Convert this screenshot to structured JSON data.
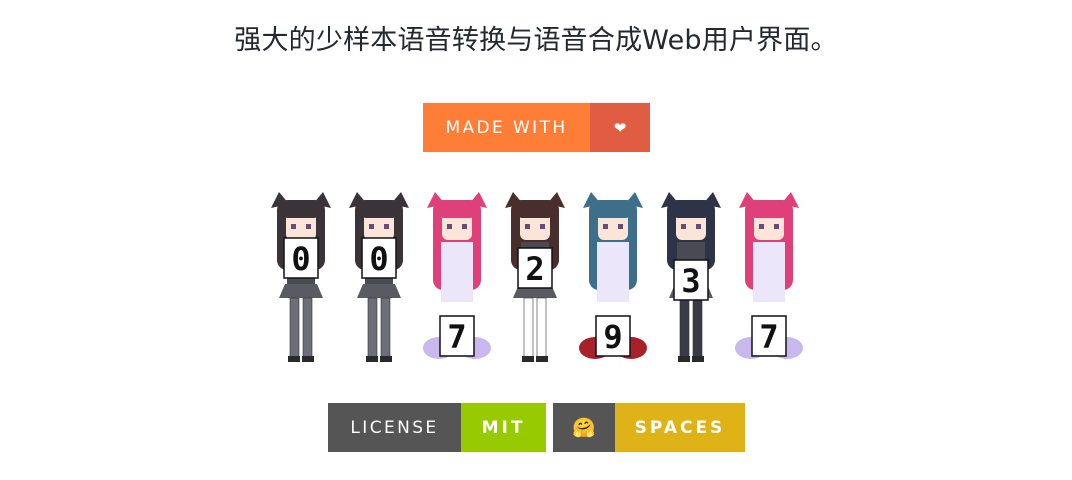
{
  "header": {
    "title": "强大的少样本语音转换与语音合成Web用户界面。"
  },
  "badges": {
    "made_with": {
      "label": "MADE WITH",
      "value": "❤",
      "label_color": "#fe7d37",
      "value_color": "#e05d44"
    },
    "license": {
      "label": "LICENSE",
      "value": "MIT",
      "label_color": "#555555",
      "value_color": "#97ca00"
    },
    "spaces": {
      "label": "🤗",
      "value": "SPACES",
      "label_color": "#555555",
      "value_color": "#dfb317"
    }
  },
  "counter": {
    "digits": [
      "0",
      "0",
      "7",
      "2",
      "9",
      "3",
      "7"
    ]
  },
  "icons": {
    "heart": "heart-icon",
    "hugging_face": "hugging-face-icon"
  }
}
